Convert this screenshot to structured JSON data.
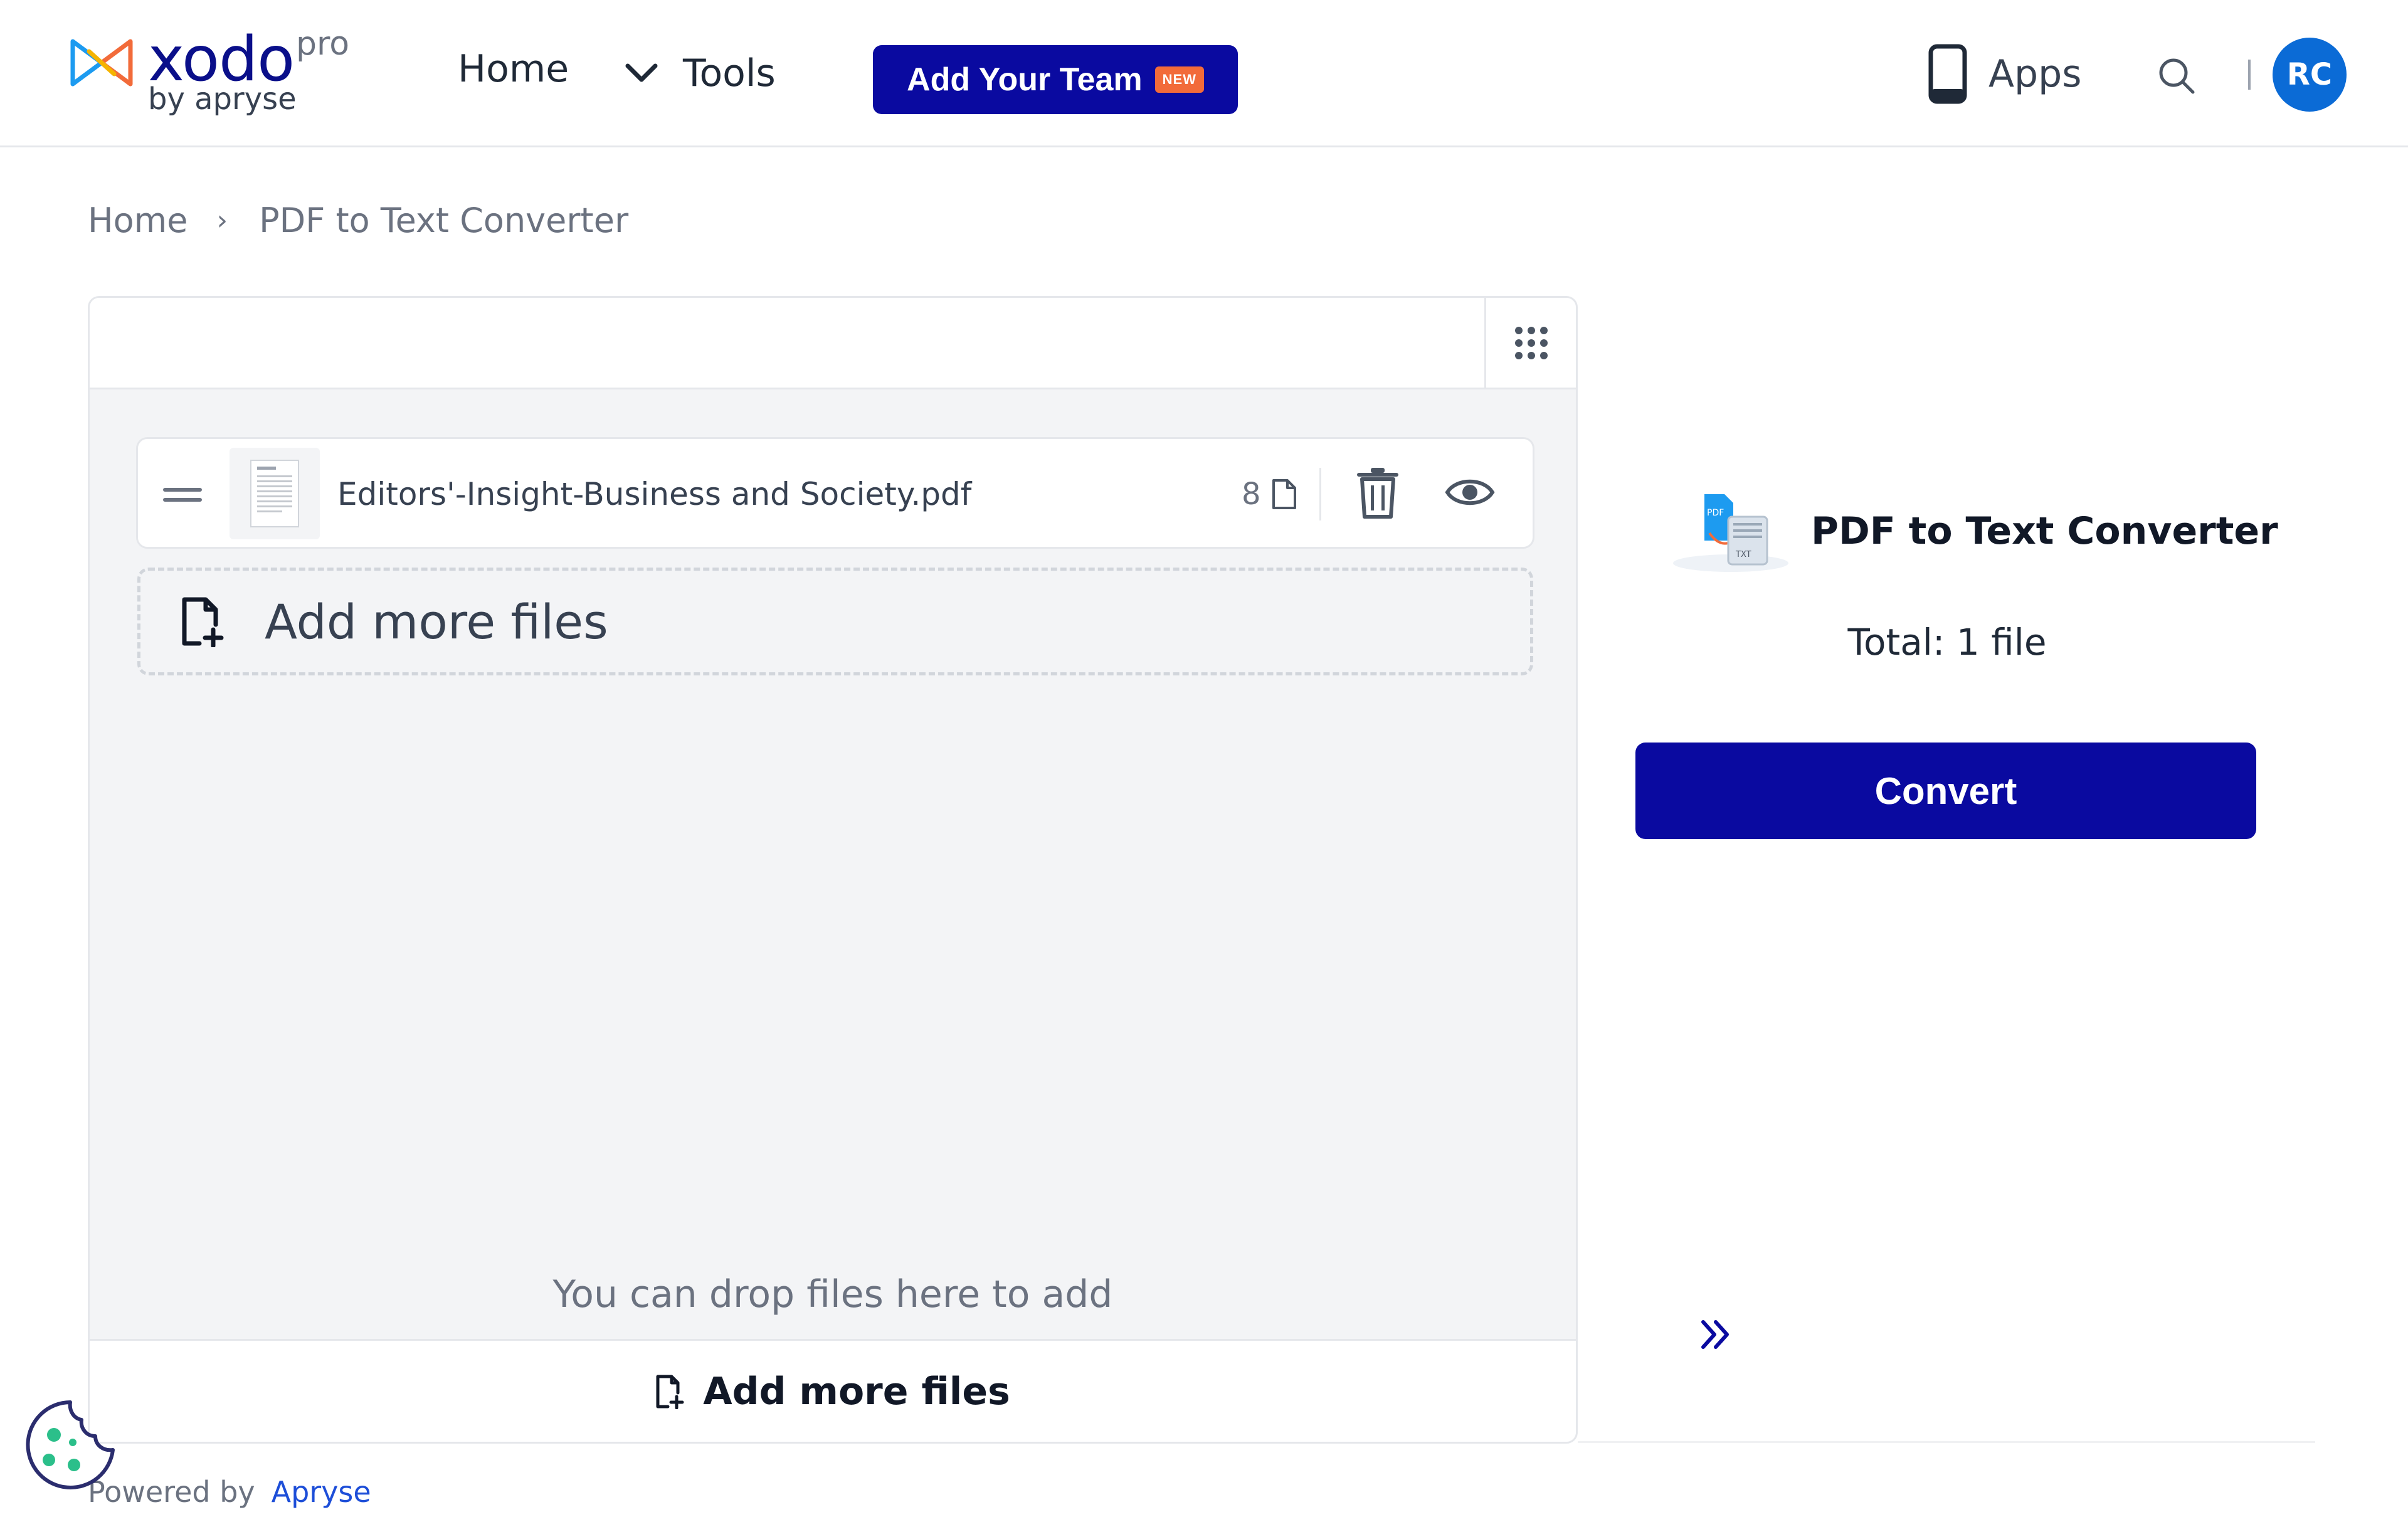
{
  "brand": {
    "name": "xodo",
    "tier": "pro",
    "sub": "by apryse",
    "colors": {
      "primary": "#0a0aa0",
      "badge": "#f26b3a",
      "avatar": "#0b6bd6"
    }
  },
  "nav": {
    "home": "Home",
    "tools": "Tools",
    "team_button": "Add Your Team",
    "team_badge": "NEW",
    "apps": "Apps",
    "avatar_initials": "RC"
  },
  "breadcrumb": [
    "Home",
    "PDF to Text Converter"
  ],
  "files": [
    {
      "name": "Editors'-Insight-Business and Society.pdf",
      "pages": "8"
    }
  ],
  "add_more_label": "Add more files",
  "drop_hint": "You can drop files here to add",
  "bottom_add_label": "Add more files",
  "tool": {
    "title": "PDF to Text Converter",
    "total": "Total: 1 file",
    "convert_label": "Convert"
  },
  "footer": {
    "powered_by": "Powered by",
    "link": "Apryse"
  },
  "icons": [
    "xodo-logo-icon",
    "chevron-down-icon",
    "phone-icon",
    "search-icon",
    "grid-icon",
    "drag-handle-icon",
    "page-icon",
    "trash-icon",
    "eye-icon",
    "file-add-icon",
    "pdf-to-text-icon",
    "double-chevron-right-icon",
    "cookie-icon"
  ]
}
